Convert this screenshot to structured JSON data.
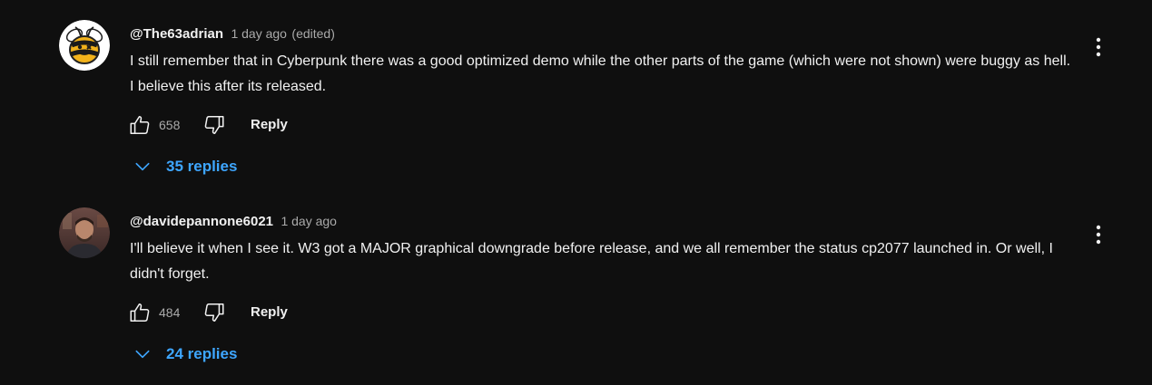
{
  "comments": [
    {
      "author": "@The63adrian",
      "time": "1 day ago",
      "edited": "(edited)",
      "text": "I still remember that in Cyberpunk there was a good optimized demo while the other parts of the game (which were not shown) were buggy as hell. I believe this after its released.",
      "likes": "658",
      "reply_label": "Reply",
      "replies_label": "35 replies",
      "avatar_icon": "bee-avatar-icon"
    },
    {
      "author": "@davidepannone6021",
      "time": "1 day ago",
      "text": "I'll believe it when I see it. W3 got a MAJOR graphical downgrade before release, and we all remember the status cp2077 launched in. Or well, I didn't forget.",
      "likes": "484",
      "reply_label": "Reply",
      "replies_label": "24 replies",
      "avatar_icon": "photo-avatar-icon"
    }
  ],
  "colors": {
    "background": "#0f0f0f",
    "text": "#f1f1f1",
    "secondary_text": "#aaaaaa",
    "link_blue": "#3ea6ff"
  },
  "icons": {
    "like": "thumbs-up-icon",
    "dislike": "thumbs-down-icon",
    "expand": "chevron-down-icon",
    "more": "more-vertical-icon"
  }
}
